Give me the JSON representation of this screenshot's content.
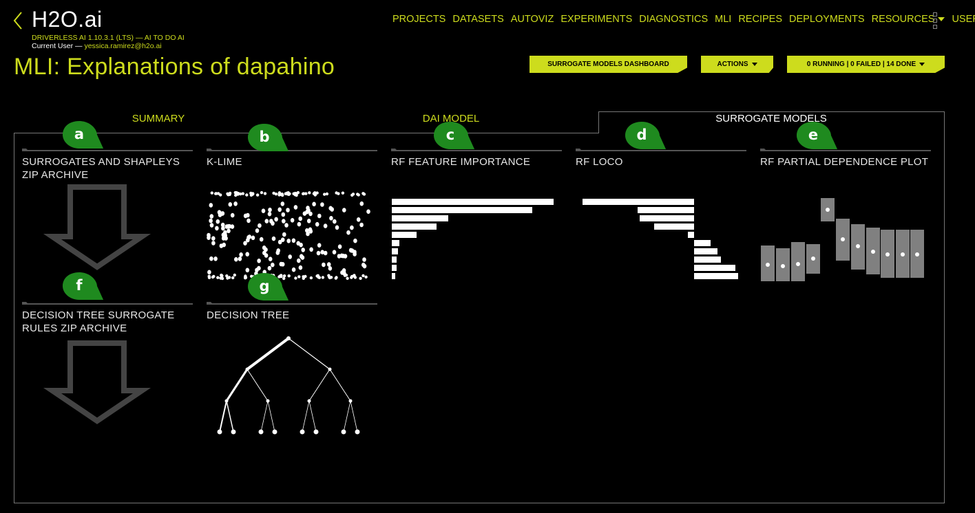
{
  "header": {
    "logo": "H2O.ai",
    "version": "DRIVERLESS AI 1.10.3.1 (LTS) — AI TO DO AI",
    "user_prefix": "Current User — ",
    "user_email": "yessica.ramirez@h2o.ai",
    "page_title": "MLI: Explanations of dapahino"
  },
  "nav": {
    "projects": "PROJECTS",
    "datasets": "DATASETS",
    "autoviz": "AUTOVIZ",
    "experiments": "EXPERIMENTS",
    "diagnostics": "DIAGNOSTICS",
    "mli": "MLI",
    "recipes": "RECIPES",
    "deployments": "DEPLOYMENTS",
    "resources": "RESOURCES",
    "user": "USER"
  },
  "actions": {
    "surrogate_dashboard": "SURROGATE MODELS DASHBOARD",
    "actions": "ACTIONS",
    "status": "0 RUNNING | 0 FAILED | 14 DONE"
  },
  "tabs": {
    "summary": "SUMMARY",
    "dai_model": "DAI MODEL",
    "surrogate_models": "SURROGATE MODELS"
  },
  "cards": {
    "zip_archive": "SURROGATES AND SHAPLEYS ZIP ARCHIVE",
    "klime": "K-LIME",
    "rf_feature_importance": "RF FEATURE IMPORTANCE",
    "rf_loco": "RF LOCO",
    "rf_pdp": "RF PARTIAL DEPENDENCE PLOT",
    "dt_rules_zip": "DECISION TREE SURROGATE RULES ZIP ARCHIVE",
    "decision_tree": "DECISION TREE"
  },
  "markers": {
    "a": "a",
    "b": "b",
    "c": "c",
    "d": "d",
    "e": "e",
    "f": "f",
    "g": "g"
  },
  "colors": {
    "accent": "#cddc1d",
    "marker": "#1f8a1f",
    "thumb": "#ffffff",
    "pdp_bar": "#808080",
    "arrow": "#444444"
  }
}
